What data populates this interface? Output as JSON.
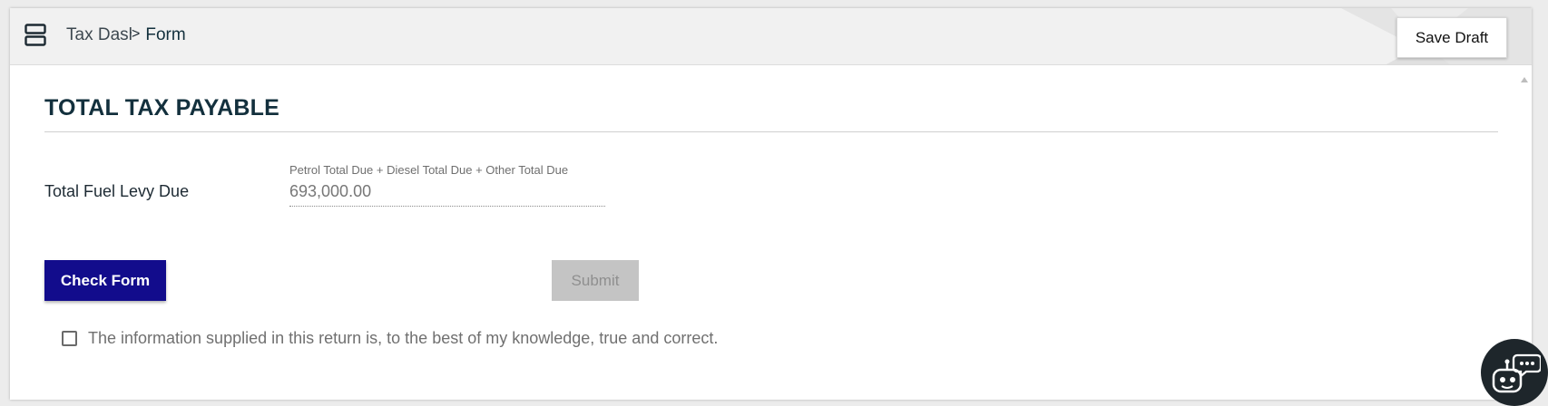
{
  "header": {
    "breadcrumb_parent": "Tax Dashboard",
    "breadcrumb_separator": ">",
    "breadcrumb_current": "Form",
    "save_draft_label": "Save Draft"
  },
  "section": {
    "title": "TOTAL TAX PAYABLE"
  },
  "fields": {
    "total_fuel_levy": {
      "label": "Total Fuel Levy Due",
      "hint": "Petrol Total Due + Diesel Total Due + Other Total Due",
      "value": "693,000.00"
    }
  },
  "actions": {
    "check_form_label": "Check Form",
    "submit_label": "Submit"
  },
  "declaration": {
    "text": "The information supplied in this return is, to the best of my knowledge, true and correct.",
    "checked": false
  },
  "icons": {
    "menu": "menu-icon",
    "chatbot": "robot-chat-icon"
  },
  "colors": {
    "primary": "#120c8c",
    "heading": "#13303d",
    "disabled": "#c4c4c4",
    "topbar": "#f1f1f1"
  }
}
